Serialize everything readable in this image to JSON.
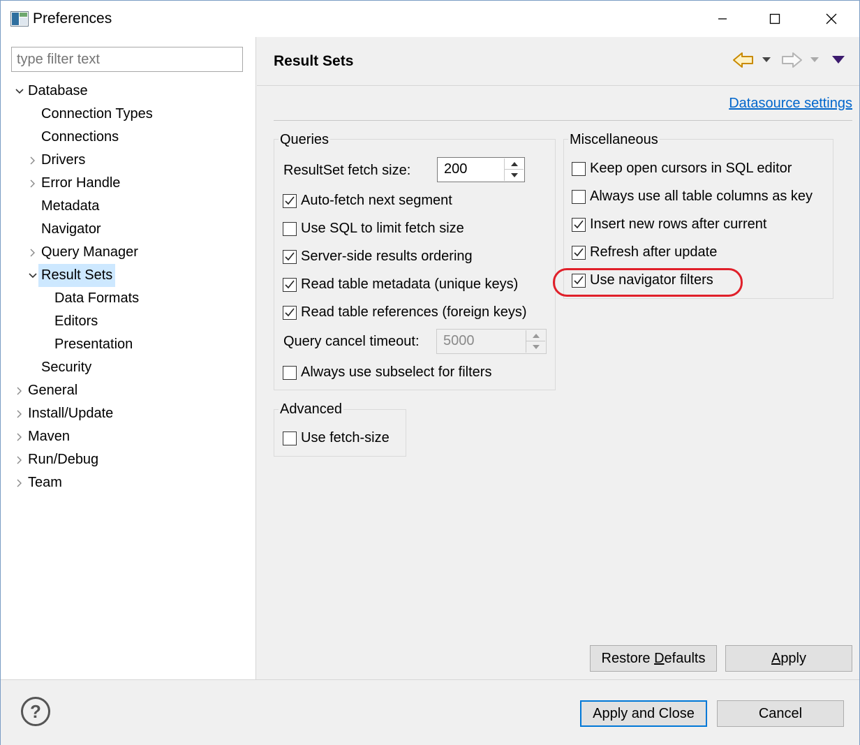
{
  "window": {
    "title": "Preferences"
  },
  "filter": {
    "placeholder": "type filter text"
  },
  "tree": [
    {
      "label": "Database",
      "arrow": "expanded",
      "level": 0
    },
    {
      "label": "Connection Types",
      "arrow": "none",
      "level": 1
    },
    {
      "label": "Connections",
      "arrow": "none",
      "level": 1
    },
    {
      "label": "Drivers",
      "arrow": "collapsed",
      "level": 1
    },
    {
      "label": "Error Handle",
      "arrow": "collapsed",
      "level": 1
    },
    {
      "label": "Metadata",
      "arrow": "none",
      "level": 1
    },
    {
      "label": "Navigator",
      "arrow": "none",
      "level": 1
    },
    {
      "label": "Query Manager",
      "arrow": "collapsed",
      "level": 1
    },
    {
      "label": "Result Sets",
      "arrow": "expanded",
      "level": 1,
      "selected": true
    },
    {
      "label": "Data Formats",
      "arrow": "none",
      "level": 2
    },
    {
      "label": "Editors",
      "arrow": "none",
      "level": 2
    },
    {
      "label": "Presentation",
      "arrow": "none",
      "level": 2
    },
    {
      "label": "Security",
      "arrow": "none",
      "level": 1
    },
    {
      "label": "General",
      "arrow": "collapsed",
      "level": 0
    },
    {
      "label": "Install/Update",
      "arrow": "collapsed",
      "level": 0
    },
    {
      "label": "Maven",
      "arrow": "collapsed",
      "level": 0
    },
    {
      "label": "Run/Debug",
      "arrow": "collapsed",
      "level": 0
    },
    {
      "label": "Team",
      "arrow": "collapsed",
      "level": 0
    }
  ],
  "page": {
    "title": "Result Sets",
    "datasource_link": "Datasource settings"
  },
  "queries": {
    "title": "Queries",
    "fetch_size_label": "ResultSet fetch size:",
    "fetch_size_value": "200",
    "checkboxes": [
      {
        "label": "Auto-fetch next segment",
        "checked": true
      },
      {
        "label": "Use SQL to limit fetch size",
        "checked": false
      },
      {
        "label": "Server-side results ordering",
        "checked": true
      },
      {
        "label": "Read table metadata (unique keys)",
        "checked": true
      },
      {
        "label": "Read table references (foreign keys)",
        "checked": true
      }
    ],
    "cancel_timeout_label": "Query cancel timeout:",
    "cancel_timeout_value": "5000",
    "subselect": {
      "label": "Always use subselect for filters",
      "checked": false
    }
  },
  "advanced": {
    "title": "Advanced",
    "checkboxes": [
      {
        "label": "Use fetch-size",
        "checked": false
      }
    ]
  },
  "misc": {
    "title": "Miscellaneous",
    "checkboxes": [
      {
        "label": "Keep open cursors in SQL editor",
        "checked": false
      },
      {
        "label": "Always use all table columns as key",
        "checked": false
      },
      {
        "label": "Insert new rows after current",
        "checked": true
      },
      {
        "label": "Refresh after update",
        "checked": true
      },
      {
        "label": "Use navigator filters",
        "checked": true
      }
    ]
  },
  "buttons": {
    "restore_pre": "Restore ",
    "restore_u": "D",
    "restore_post": "efaults",
    "apply_u": "A",
    "apply_post": "pply",
    "apply_close": "Apply and Close",
    "cancel": "Cancel"
  },
  "help": {
    "glyph": "?"
  },
  "colors": {
    "accent": "#0078d7",
    "link": "#0066cc",
    "selection": "#cde8ff",
    "annotation": "#e0202a"
  },
  "icons": [
    "app-icon",
    "minimize-icon",
    "maximize-icon",
    "close-icon",
    "back-arrow-icon",
    "forward-arrow-icon",
    "view-menu-icon",
    "help-icon"
  ]
}
